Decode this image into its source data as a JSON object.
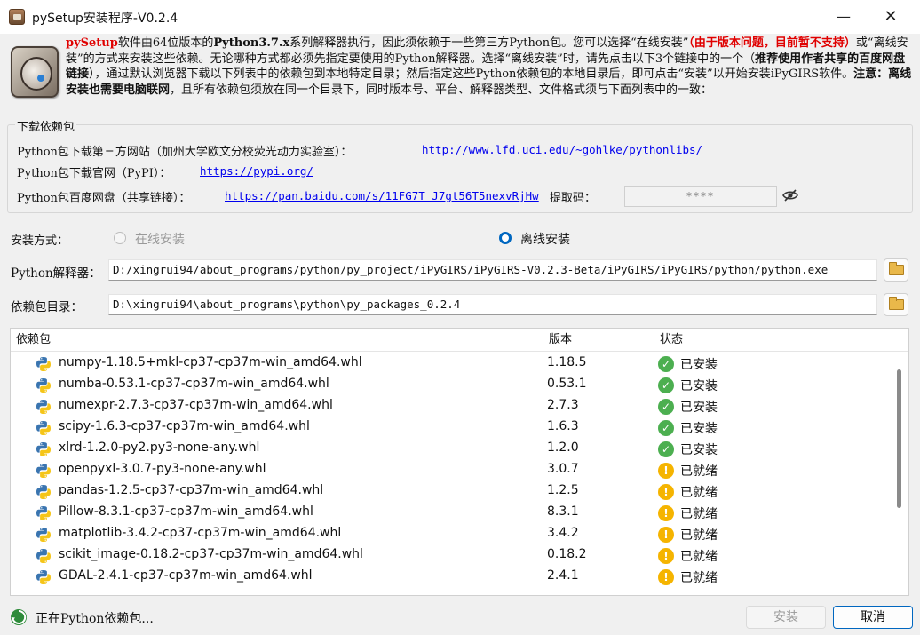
{
  "window": {
    "title": "pySetup安装程序-V0.2.4",
    "minimize_glyph": "—",
    "close_glyph": "✕"
  },
  "intro": {
    "p1": "pySetup",
    "p2": "软件由64位版本的",
    "p3": "Python3.7.x",
    "p4": "系列解释器执行，因此须依赖于一些第三方Python包。您可以选择“在线安装”",
    "p5": "（由于版本问题，目前暂不支持）",
    "p6": "或“离线安装”的方式来安装这些依赖。无论哪种方式都必须先指定要使用的Python解释器。选择“离线安装”时，请先点击以下3个链接中的一个（",
    "p7": "推荐使用作者共享的百度网盘链接",
    "p8": "），通过默认浏览器下载以下列表中的依赖包到本地特定目录；然后指定这些Python依赖包的本地目录后，即可点击“安装”以开始安装iPyGIRS软件。",
    "p9": "注意：离线安装也需要电脑联网",
    "p10": "，且所有依赖包须放在同一个目录下，同时版本号、平台、解释器类型、文件格式须与下面列表中的一致："
  },
  "download": {
    "group_title": "下载依赖包",
    "uci_label": "Python包下载第三方网站（加州大学欧文分校荧光动力实验室）：",
    "uci_link": "http://www.lfd.uci.edu/~gohlke/pythonlibs/",
    "pypi_label": "Python包下载官网（PyPI）：",
    "pypi_link": "https://pypi.org/",
    "baidu_label": "Python包百度网盘（共享链接）：",
    "baidu_link": "https://pan.baidu.com/s/11FG7T_J7gt56T5nexvRjHw",
    "code_label": "提取码：",
    "code_value": "****"
  },
  "install_mode": {
    "label": "安装方式：",
    "online": "在线安装",
    "offline": "离线安装",
    "selected": "offline"
  },
  "interpreter": {
    "label": "Python解释器：",
    "value": "D:/xingrui94/about_programs/python/py_project/iPyGIRS/iPyGIRS-V0.2.3-Beta/iPyGIRS/iPyGIRS/python/python.exe"
  },
  "package_dir": {
    "label": "依赖包目录：",
    "value": "D:\\xingrui94\\about_programs\\python\\py_packages_0.2.4"
  },
  "table": {
    "headers": {
      "package": "依赖包",
      "version": "版本",
      "status": "状态"
    },
    "rows": [
      {
        "name": "numpy-1.18.5+mkl-cp37-cp37m-win_amd64.whl",
        "version": "1.18.5",
        "status": "已安装",
        "state": "ok"
      },
      {
        "name": "numba-0.53.1-cp37-cp37m-win_amd64.whl",
        "version": "0.53.1",
        "status": "已安装",
        "state": "ok"
      },
      {
        "name": "numexpr-2.7.3-cp37-cp37m-win_amd64.whl",
        "version": "2.7.3",
        "status": "已安装",
        "state": "ok"
      },
      {
        "name": "scipy-1.6.3-cp37-cp37m-win_amd64.whl",
        "version": "1.6.3",
        "status": "已安装",
        "state": "ok"
      },
      {
        "name": "xlrd-1.2.0-py2.py3-none-any.whl",
        "version": "1.2.0",
        "status": "已安装",
        "state": "ok"
      },
      {
        "name": "openpyxl-3.0.7-py3-none-any.whl",
        "version": "3.0.7",
        "status": "已就绪",
        "state": "ready"
      },
      {
        "name": "pandas-1.2.5-cp37-cp37m-win_amd64.whl",
        "version": "1.2.5",
        "status": "已就绪",
        "state": "ready"
      },
      {
        "name": "Pillow-8.3.1-cp37-cp37m-win_amd64.whl",
        "version": "8.3.1",
        "status": "已就绪",
        "state": "ready"
      },
      {
        "name": "matplotlib-3.4.2-cp37-cp37m-win_amd64.whl",
        "version": "3.4.2",
        "status": "已就绪",
        "state": "ready"
      },
      {
        "name": "scikit_image-0.18.2-cp37-cp37m-win_amd64.whl",
        "version": "0.18.2",
        "status": "已就绪",
        "state": "ready"
      },
      {
        "name": "GDAL-2.4.1-cp37-cp37m-win_amd64.whl",
        "version": "2.4.1",
        "status": "已就绪",
        "state": "ready"
      }
    ]
  },
  "colors": {
    "accent": "#0067c0",
    "ok": "#4caf50",
    "ready": "#f5b400",
    "warning_text": "#e00000",
    "link": "#0000ee"
  },
  "footer": {
    "status_message": "正在Python依赖包...",
    "install_label": "安装",
    "cancel_label": "取消"
  }
}
